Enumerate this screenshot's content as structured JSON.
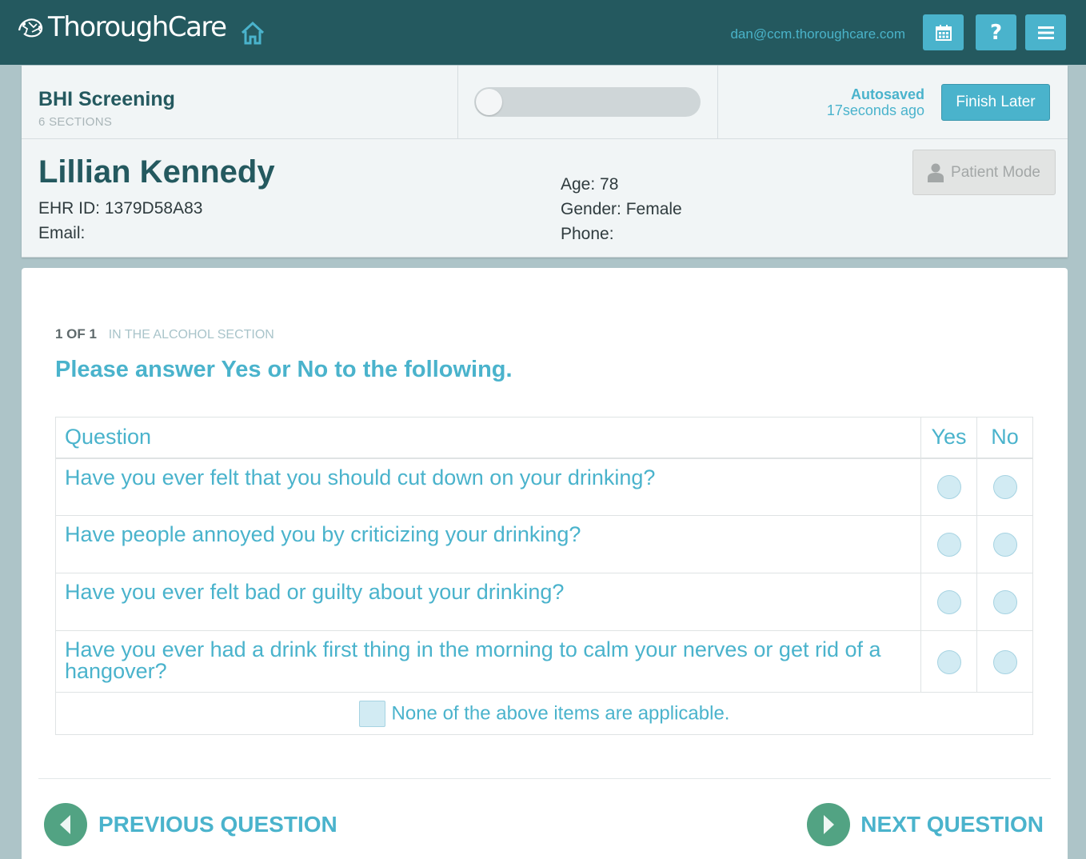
{
  "brand": {
    "name": "ThoroughCare"
  },
  "topbar": {
    "user_email": "dan@ccm.thoroughcare.com",
    "help_label": "?",
    "icons": [
      "logo-icon",
      "home-icon",
      "calendar-icon",
      "help-icon",
      "menu-icon"
    ]
  },
  "assessment": {
    "title": "BHI Screening",
    "sections": "6 SECTIONS",
    "progress_percent": 0,
    "autosaved_label": "Autosaved",
    "autosaved_time": "17seconds ago",
    "finish_later": "Finish Later"
  },
  "patient": {
    "name": "Lillian Kennedy",
    "ehr_id": "EHR ID: 1379D58A83",
    "email": "Email:",
    "age": "Age: 78",
    "gender": "Gender: Female",
    "phone": "Phone:",
    "patient_mode": "Patient Mode"
  },
  "question": {
    "count": "1 OF 1",
    "section": "IN THE ALCOHOL SECTION",
    "prompt": "Please answer Yes or No to the following.",
    "table": {
      "headers": [
        "Question",
        "Yes",
        "No"
      ],
      "rows": [
        "Have you ever felt that you should cut down on your drinking?",
        "Have people annoyed you by criticizing your drinking?",
        "Have you ever felt bad or guilty about your drinking?",
        "Have you ever had a drink first thing in the morning to calm your nerves or get rid of a hangover?"
      ],
      "none_label": "None of the above items are applicable."
    }
  },
  "nav": {
    "previous": "PREVIOUS QUESTION",
    "next": "NEXT QUESTION"
  },
  "colors": {
    "topbar": "#24595f",
    "accent": "#4ab3cc",
    "nav_circle": "#52a383",
    "background": "#adc4c8"
  }
}
